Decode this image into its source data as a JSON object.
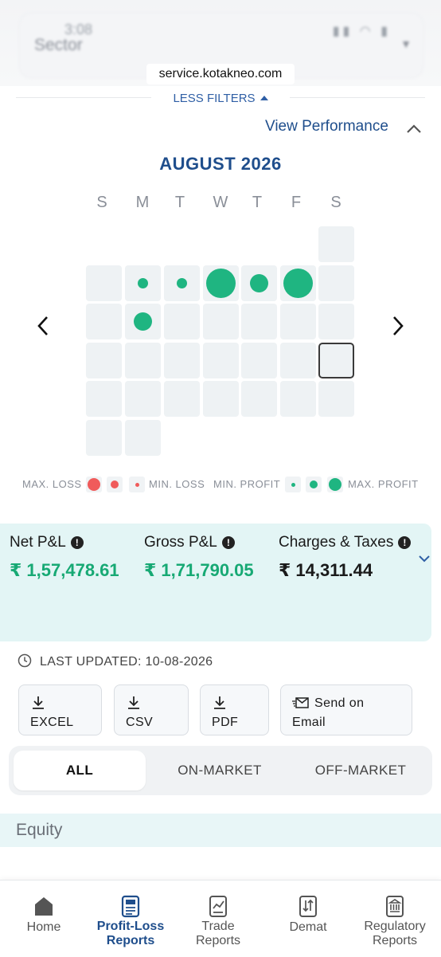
{
  "overlay": {
    "sector_placeholder": "Sector",
    "status_time": "3:08",
    "status_icons": "▮▮ ◠ ▮",
    "url": "service.kotakneo.com"
  },
  "filters": {
    "less_filters": "LESS FILTERS"
  },
  "performance": {
    "view_label": "View Performance"
  },
  "calendar": {
    "month_title": "AUGUST 2026",
    "weekdays": [
      "S",
      "M",
      "T",
      "W",
      "T",
      "F",
      "S"
    ],
    "profit_color": "#1fb581",
    "loss_color": "#f05b5b"
  },
  "legend": {
    "max_loss": "MAX. LOSS",
    "min_loss": "MIN. LOSS",
    "min_profit": "MIN. PROFIT",
    "max_profit": "MAX. PROFIT"
  },
  "pnl": {
    "net_label": "Net P&L",
    "net_value": "₹ 1,57,478.61",
    "gross_label": "Gross P&L",
    "gross_value": "₹ 1,71,790.05",
    "charges_label": "Charges & Taxes",
    "charges_value": "₹ 14,311.44"
  },
  "last_updated": "LAST UPDATED: 10-08-2026",
  "downloads": {
    "excel": "EXCEL",
    "csv": "CSV",
    "pdf": "PDF",
    "send_line1": "Send on",
    "send_line2": "Email"
  },
  "market_tabs": {
    "all": "ALL",
    "on_market": "ON-MARKET",
    "off_market": "OFF-MARKET"
  },
  "section": {
    "equity": "Equity"
  },
  "bottom_nav": {
    "home": "Home",
    "pl_line1": "Profit-Loss",
    "pl_line2": "Reports",
    "trade_line1": "Trade",
    "trade_line2": "Reports",
    "demat": "Demat",
    "reg_line1": "Regulatory",
    "reg_line2": "Reports"
  }
}
